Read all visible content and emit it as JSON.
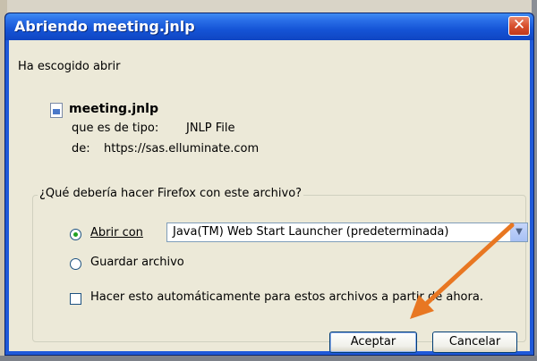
{
  "dialog": {
    "title": "Abriendo meeting.jnlp",
    "close_glyph": "✕"
  },
  "info": {
    "intro": "Ha escogido abrir",
    "filename": "meeting.jnlp",
    "type_label": "que es de tipo:",
    "type_value": "JNLP File",
    "from_label": "de:",
    "from_value": "https://sas.elluminate.com"
  },
  "question": {
    "title": "¿Qué debería hacer Firefox con este archivo?",
    "open_with_label": "Abrir con",
    "open_with_selected": true,
    "app_select_value": "Java(TM) Web Start Launcher (predeterminada)",
    "save_label": "Guardar archivo",
    "save_selected": false,
    "auto_label": "Hacer esto automáticamente para estos archivos a partir de ahora.",
    "auto_checked": false
  },
  "buttons": {
    "accept": "Aceptar",
    "cancel": "Cancelar"
  },
  "annotation": {
    "arrow_color": "#e87722"
  }
}
